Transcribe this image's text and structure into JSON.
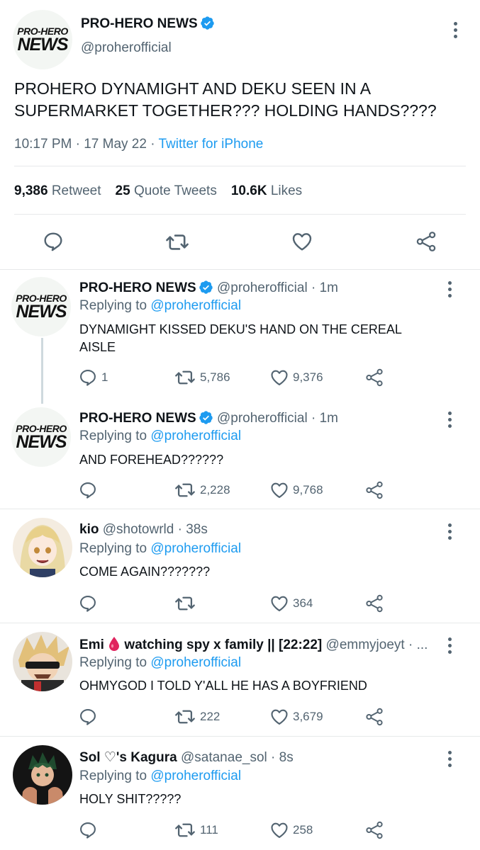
{
  "main": {
    "author_name": "PRO-HERO NEWS",
    "author_handle": "@proherofficial",
    "logo_line1": "PRO-HERO",
    "logo_line2": "NEWS",
    "text": "PROHERO DYNAMIGHT AND DEKU SEEN IN A SUPERMARKET TOGETHER??? HOLDING HANDS????",
    "time": "10:17 PM",
    "date": "17 May 22",
    "source": "Twitter for iPhone",
    "retweets_count": "9,386",
    "retweets_label": "Retweet",
    "quotes_count": "25",
    "quotes_label": "Quote Tweets",
    "likes_count": "10.6K",
    "likes_label": "Likes"
  },
  "replies": [
    {
      "name": "PRO-HERO NEWS",
      "handle": "@proherofficial",
      "time": "1m",
      "replying_prefix": "Replying to",
      "replying_to": "@proherofficial",
      "text": "DYNAMIGHT KISSED DEKU'S HAND ON THE CEREAL AISLE",
      "reply_count": "1",
      "retweet_count": "5,786",
      "like_count": "9,376"
    },
    {
      "name": "PRO-HERO NEWS",
      "handle": "@proherofficial",
      "time": "1m",
      "replying_prefix": "Replying to",
      "replying_to": "@proherofficial",
      "text": "AND FOREHEAD??????",
      "reply_count": "",
      "retweet_count": "2,228",
      "like_count": "9,768"
    },
    {
      "name": "kio",
      "handle": "@shotowrld",
      "time": "38s",
      "replying_prefix": "Replying to",
      "replying_to": "@proherofficial",
      "text": "COME AGAIN???????",
      "reply_count": "",
      "retweet_count": "",
      "like_count": "364"
    },
    {
      "name": "Emi",
      "name_suffix": "watching spy x family || [22:22]",
      "handle": "@emmyjoeyt",
      "time": "...",
      "replying_prefix": "Replying to",
      "replying_to": "@proherofficial",
      "text": "OHMYGOD I TOLD Y'ALL HE HAS A BOYFRIEND",
      "reply_count": "",
      "retweet_count": "222",
      "like_count": "3,679"
    },
    {
      "name": "Sol ♡'s Kagura",
      "handle": "@satanae_sol",
      "time": "8s",
      "replying_prefix": "Replying to",
      "replying_to": "@proherofficial",
      "text": "HOLY SHIT?????",
      "reply_count": "",
      "retweet_count": "111",
      "like_count": "258"
    }
  ],
  "icons": {
    "verified": "verified-badge-icon",
    "reply": "reply-bubble-icon",
    "retweet": "retweet-icon",
    "like": "heart-icon",
    "share": "share-icon",
    "more": "more-vertical-icon",
    "blood_drop": "blood-drop-icon"
  },
  "colors": {
    "accent": "#1d9bf0",
    "muted": "#536471",
    "text": "#0f1419",
    "divider": "#e7e9ea",
    "drop": "#e0245e"
  }
}
